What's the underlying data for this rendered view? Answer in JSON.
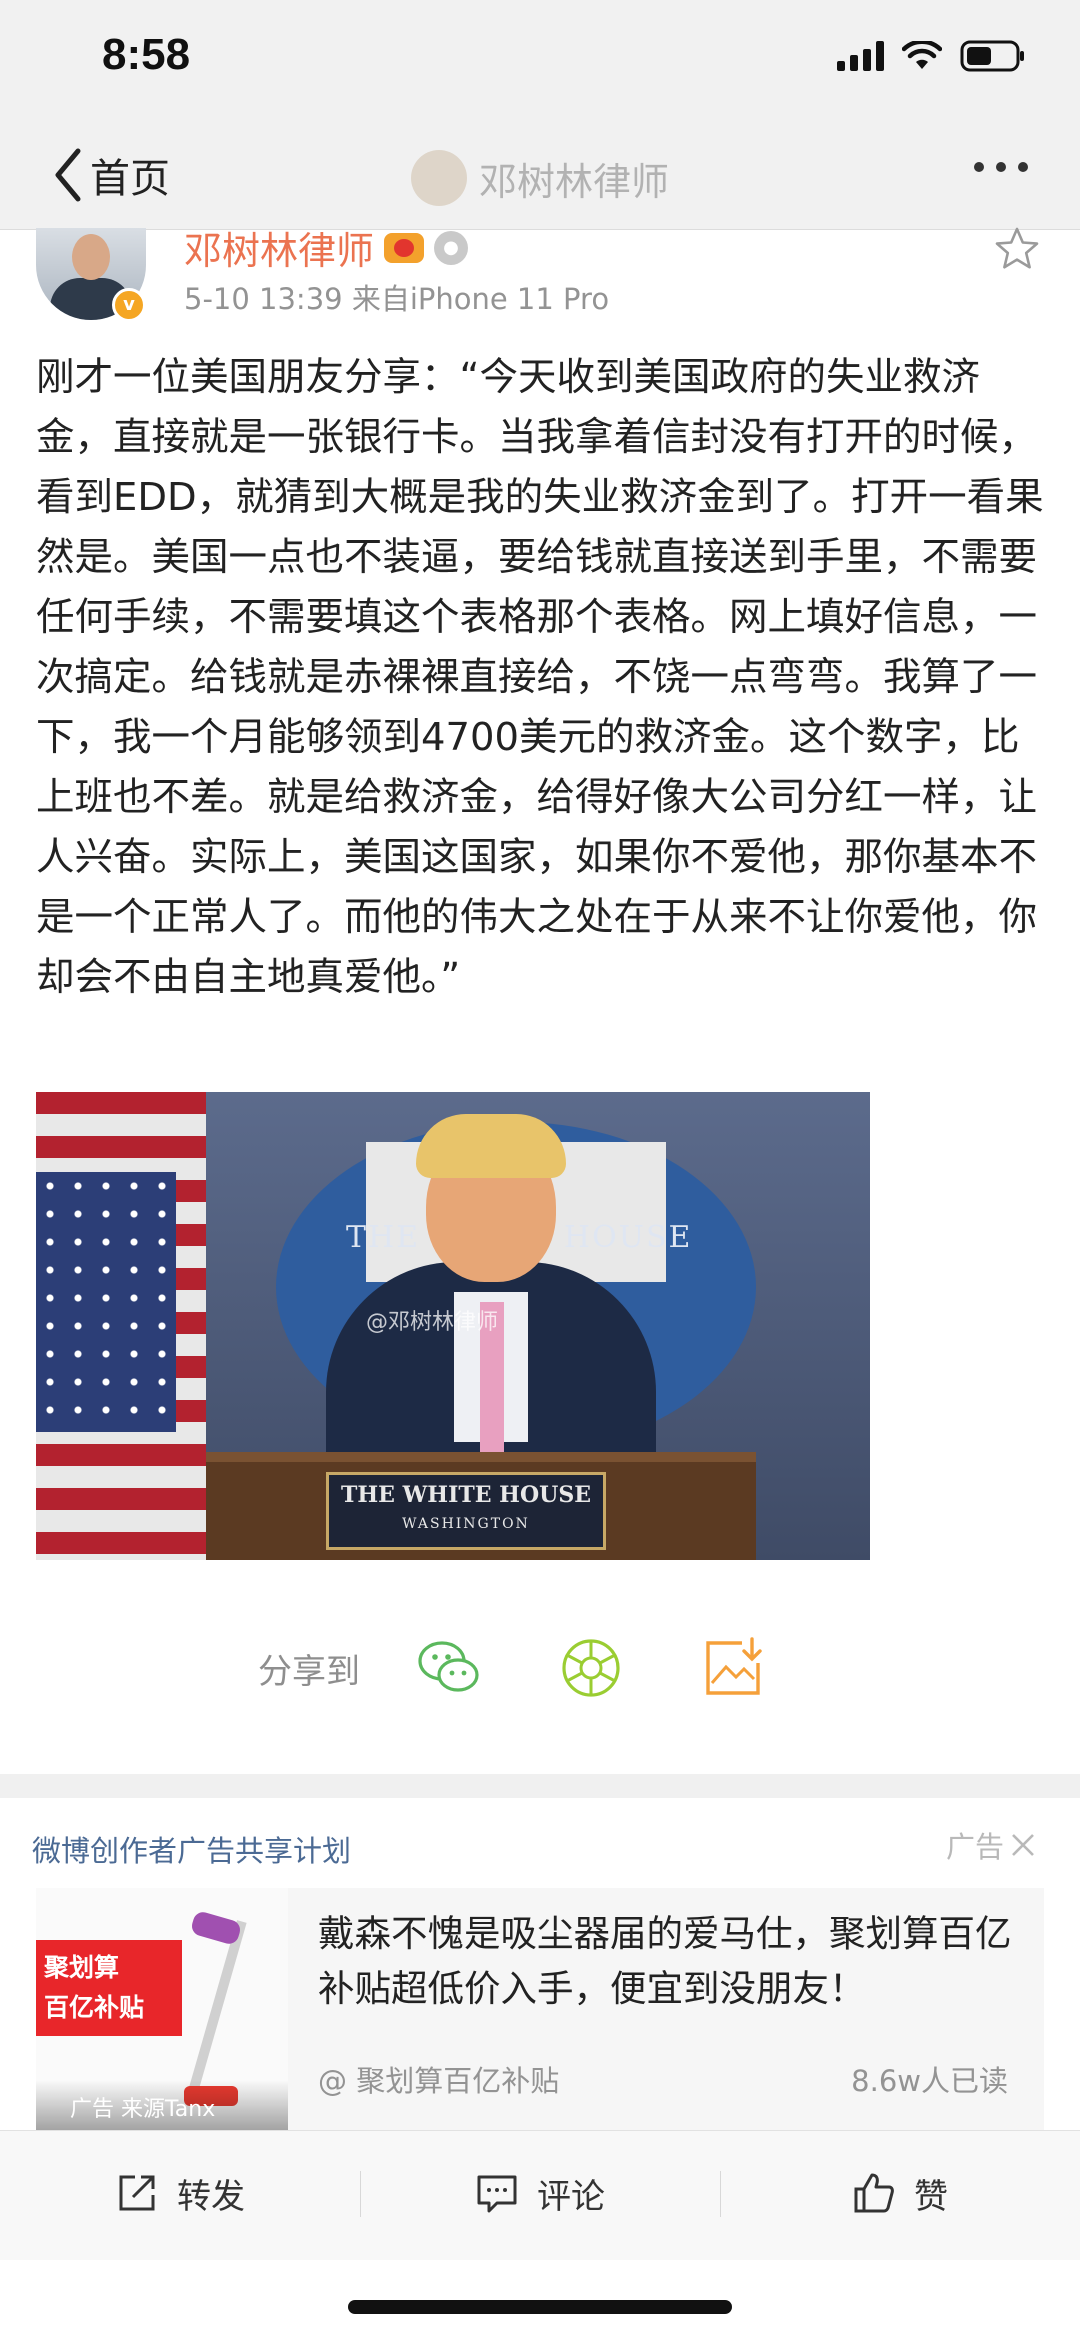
{
  "status_bar": {
    "time": "8:58"
  },
  "nav": {
    "back_label": "首页",
    "title": "邓树林律师"
  },
  "post": {
    "author": "邓树林律师",
    "meta": "5-10 13:39  来自iPhone 11 Pro",
    "text": "刚才一位美国朋友分享：“今天收到美国政府的失业救济金，直接就是一张银行卡。当我拿着信封没有打开的时候，看到EDD，就猜到大概是我的失业救济金到了。打开一看果然是。美国一点也不装逼，要给钱就直接送到手里，不需要任何手续，不需要填这个表格那个表格。网上填好信息，一次搞定。给钱就是赤裸裸直接给，不饶一点弯弯。我算了一下，我一个月能够领到4700美元的救济金。这个数字，比上班也不差。就是给救济金，给得好像大公司分红一样，让人兴奋。实际上，美国这国家，如果你不爱他，那你基本不是一个正常人了。而他的伟大之处在于从来不让你爱他，你却会不由自主地真爱他。”",
    "image": {
      "seal_text": "THE WHITE HOUSE",
      "podium_title": "THE WHITE HOUSE",
      "podium_subtitle": "WASHINGTON",
      "watermark": "@邓树林律师"
    }
  },
  "share": {
    "label": "分享到",
    "icons": [
      "wechat-icon",
      "moments-icon",
      "save-image-icon"
    ]
  },
  "ad": {
    "program": "微博创作者广告共享计划",
    "tag": "广告",
    "thumb_line1": "聚划算",
    "thumb_line2": "百亿补贴",
    "thumb_source": "广告 来源Tanx",
    "title": "戴森不愧是吸尘器届的爱马仕，聚划算百亿补贴超低价入手，便宜到没朋友！",
    "account": "@ 聚划算百亿补贴",
    "reads": "8.6w人已读"
  },
  "toolbar": {
    "repost_label": "转发",
    "comment_label": "评论",
    "like_label": "赞"
  },
  "colors": {
    "author": "#eb7350",
    "ad_program": "#4b6a94",
    "wechat": "#5bb85d",
    "moments": "#9acd32",
    "save": "#f5a03a"
  }
}
